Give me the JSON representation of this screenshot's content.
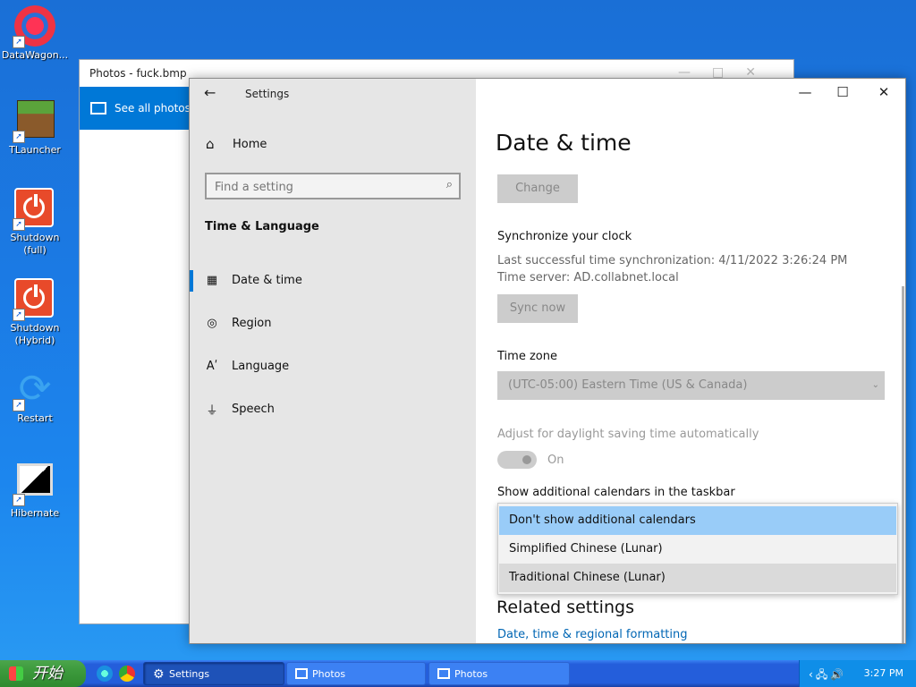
{
  "desktop": {
    "icons": [
      {
        "label": "DataWagon...",
        "icon": "gear-icon"
      },
      {
        "label": "TLauncher",
        "icon": "grass-block-icon"
      },
      {
        "label": "Shutdown\n(full)",
        "icon": "power-icon"
      },
      {
        "label": "Shutdown\n(Hybrid)",
        "icon": "power-icon"
      },
      {
        "label": "Restart",
        "icon": "restart-icon"
      },
      {
        "label": "Hibernate",
        "icon": "monitor-icon"
      }
    ]
  },
  "photos": {
    "title": "Photos - fuck.bmp",
    "nav_label": "See all photos"
  },
  "settings": {
    "window_title": "Settings",
    "home_label": "Home",
    "search_placeholder": "Find a setting",
    "section_title": "Time & Language",
    "nav_items": [
      {
        "label": "Date & time",
        "icon": "calendar-clock-icon",
        "selected": true
      },
      {
        "label": "Region",
        "icon": "globe-icon",
        "selected": false
      },
      {
        "label": "Language",
        "icon": "language-icon",
        "selected": false
      },
      {
        "label": "Speech",
        "icon": "microphone-icon",
        "selected": false
      }
    ],
    "page_title": "Date & time",
    "change_button": "Change",
    "sync_heading": "Synchronize your clock",
    "last_sync": "Last successful time synchronization: 4/11/2022 3:26:24 PM",
    "time_server": "Time server: AD.collabnet.local",
    "sync_button": "Sync now",
    "timezone_label": "Time zone",
    "timezone_value": "(UTC-05:00) Eastern Time (US & Canada)",
    "dst_label": "Adjust for daylight saving time automatically",
    "dst_toggle_state": "On",
    "calendars_label": "Show additional calendars in the taskbar",
    "calendar_options": [
      "Don't show additional calendars",
      "Simplified Chinese (Lunar)",
      "Traditional Chinese (Lunar)"
    ],
    "calendar_selected_index": 0,
    "related_heading": "Related settings",
    "related_link": "Date, time & regional formatting"
  },
  "taskbar": {
    "start_label": "开始",
    "tasks": [
      {
        "label": "Settings",
        "icon": "gear-icon",
        "active": true
      },
      {
        "label": "Photos",
        "icon": "photo-icon",
        "active": false
      },
      {
        "label": "Photos",
        "icon": "photo-icon",
        "active": false
      }
    ],
    "clock": "3:27 PM"
  },
  "colors": {
    "accent": "#0078d7",
    "dropdown_selected": "#99ccf8",
    "link": "#0066b4"
  }
}
